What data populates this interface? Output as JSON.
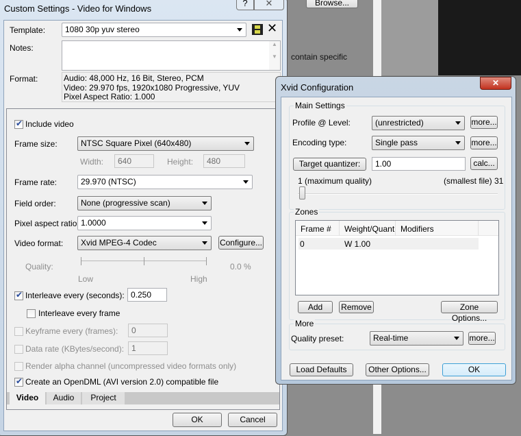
{
  "background": {
    "browse_label": "Browse...",
    "text_fragment": "contain specific"
  },
  "custom": {
    "title": "Custom Settings - Video for Windows",
    "template_label": "Template:",
    "template_value": "1080 30p yuv stereo",
    "notes_label": "Notes:",
    "notes_value": "",
    "format_label": "Format:",
    "format_lines": [
      "Audio: 48,000 Hz, 16 Bit, Stereo, PCM",
      "Video: 29.970 fps, 1920x1080 Progressive, YUV",
      "Pixel Aspect Ratio: 1.000"
    ],
    "include_video": "Include video",
    "frame_size_label": "Frame size:",
    "frame_size_value": "NTSC Square Pixel (640x480)",
    "width_label": "Width:",
    "width_value": "640",
    "height_label": "Height:",
    "height_value": "480",
    "frame_rate_label": "Frame rate:",
    "frame_rate_value": "29.970 (NTSC)",
    "field_order_label": "Field order:",
    "field_order_value": "None (progressive scan)",
    "par_label": "Pixel aspect ratio:",
    "par_value": "1.0000",
    "video_format_label": "Video format:",
    "video_format_value": "Xvid MPEG-4 Codec",
    "configure": "Configure...",
    "quality_label": "Quality:",
    "quality_low": "Low",
    "quality_high": "High",
    "quality_value": "0.0 %",
    "interleave_label": "Interleave every (seconds):",
    "interleave_value": "0.250",
    "interleave_frame": "Interleave every frame",
    "keyframe_label": "Keyframe every (frames):",
    "keyframe_value": "0",
    "datarate_label": "Data rate (KBytes/second):",
    "datarate_value": "1",
    "alpha_label": "Render alpha channel (uncompressed video formats only)",
    "opendml_label": "Create an OpenDML (AVI version 2.0) compatible file",
    "tabs": [
      "Video",
      "Audio",
      "Project"
    ],
    "ok": "OK",
    "cancel": "Cancel"
  },
  "xvid": {
    "title": "Xvid Configuration",
    "main_settings": "Main Settings",
    "profile_label": "Profile @ Level:",
    "profile_value": "(unrestricted)",
    "encoding_label": "Encoding type:",
    "encoding_value": "Single pass",
    "more": "more...",
    "target_button": "Target quantizer:",
    "target_value": "1.00",
    "calc": "calc...",
    "slider_min": "1 (maximum quality)",
    "slider_max": "(smallest file) 31",
    "slider_value": 1,
    "zones": "Zones",
    "columns": [
      "Frame #",
      "Weight/Quant",
      "Modifiers"
    ],
    "rows": [
      [
        "0",
        "W 1.00",
        ""
      ]
    ],
    "add": "Add",
    "remove": "Remove",
    "zone_options": "Zone Options...",
    "more_group": "More",
    "quality_preset_label": "Quality preset:",
    "quality_preset_value": "Real-time",
    "load_defaults": "Load Defaults",
    "other_options": "Other Options...",
    "ok": "OK"
  }
}
